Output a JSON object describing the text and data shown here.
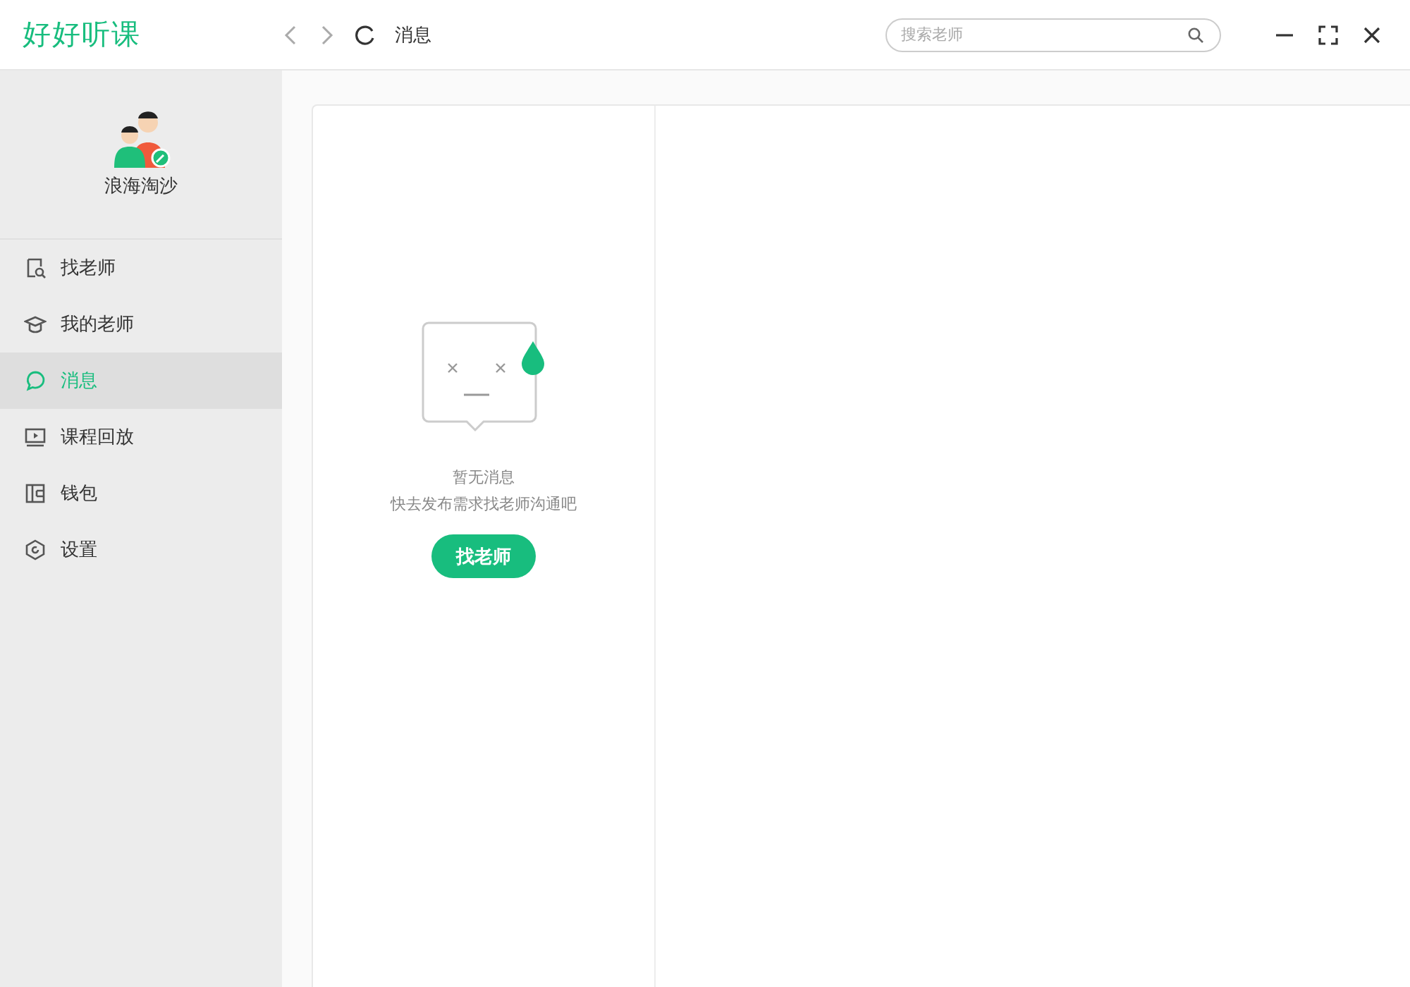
{
  "app": {
    "logo": "好好听课"
  },
  "toolbar": {
    "page_title": "消息",
    "search": {
      "placeholder": "搜索老师"
    }
  },
  "profile": {
    "username": "浪海淘沙"
  },
  "sidebar": {
    "items": [
      {
        "label": "找老师",
        "kind": "find",
        "selected": false
      },
      {
        "label": "我的老师",
        "kind": "teachers",
        "selected": false
      },
      {
        "label": "消息",
        "kind": "messages",
        "selected": true
      },
      {
        "label": "课程回放",
        "kind": "playback",
        "selected": false
      },
      {
        "label": "钱包",
        "kind": "wallet",
        "selected": false
      },
      {
        "label": "设置",
        "kind": "settings",
        "selected": false
      }
    ]
  },
  "empty_state": {
    "title": "暂无消息",
    "hint": "快去发布需求找老师沟通吧",
    "button": "找老师"
  }
}
